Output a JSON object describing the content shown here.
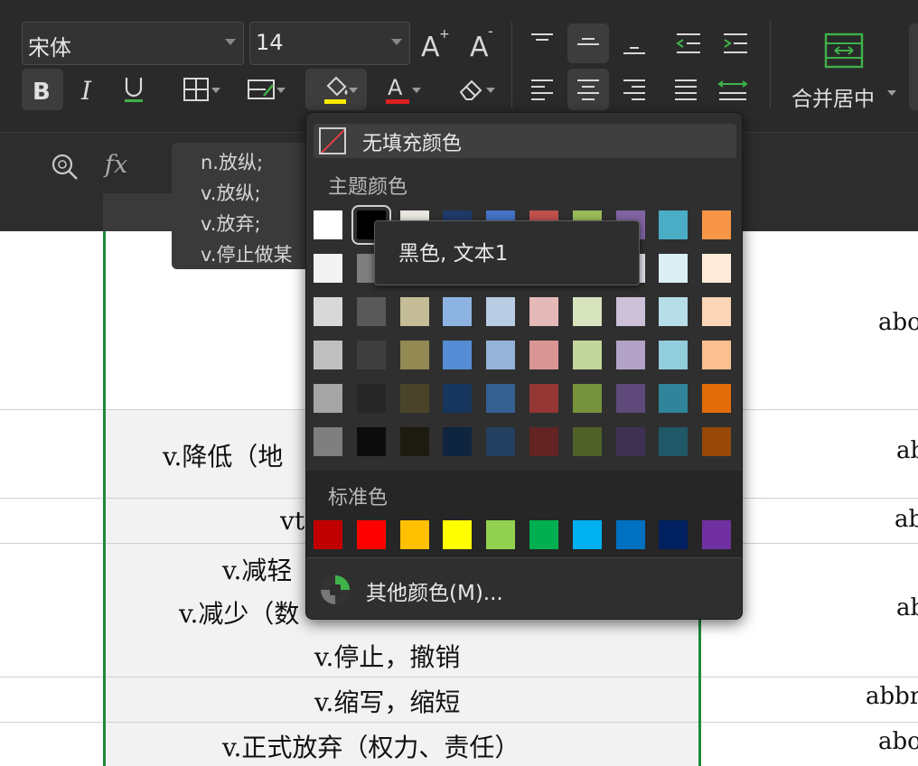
{
  "toolbar": {
    "font_name": "宋体",
    "font_size": "14",
    "merge_center": "合并居中"
  },
  "formula": {
    "fx": "fx",
    "lines": [
      "n.放纵;",
      "v.放纵;",
      "v.放弃;",
      "v.停止做某"
    ]
  },
  "sheet": {
    "rows": [
      {
        "text": "",
        "right": "abo"
      },
      {
        "text": "v.降低（地",
        "right": "ab"
      },
      {
        "text": "vt",
        "right": "ab"
      },
      {
        "text": "v.减轻",
        "text2": "v.减少（数",
        "text3": "v.停止，撤销",
        "right": "ab"
      },
      {
        "text": "v.缩写，缩短",
        "right": "abbr"
      },
      {
        "text": "v.正式放弃（权力、责任）",
        "right": "abo"
      }
    ]
  },
  "color_picker": {
    "no_fill": "无填充颜色",
    "theme_title": "主题颜色",
    "standard_title": "标准色",
    "more_colors": "其他颜色(M)...",
    "tooltip": "黑色, 文本1",
    "theme_colors": [
      [
        "#ffffff",
        "#000000",
        "#e8e6df",
        "#1f3a68",
        "#4472c4",
        "#c0504d",
        "#9bbb59",
        "#8064a2",
        "#4bacc6",
        "#f79646"
      ],
      [
        "#f2f2f2",
        "#7f7f7f",
        "#ddd9c3",
        "#c6d9f0",
        "#dbe5f1",
        "#f2dcdb",
        "#ebf1dd",
        "#e5e0ec",
        "#dbeef3",
        "#fdeada"
      ],
      [
        "#d8d8d8",
        "#595959",
        "#c4bd97",
        "#8db3e2",
        "#b8cce4",
        "#e5b9b7",
        "#d7e3bc",
        "#ccc1d9",
        "#b7dde8",
        "#fbd5b5"
      ],
      [
        "#bfbfbf",
        "#3f3f3f",
        "#938953",
        "#548dd4",
        "#95b3d7",
        "#d99694",
        "#c3d69b",
        "#b2a2c7",
        "#92cddc",
        "#fac08f"
      ],
      [
        "#a5a5a5",
        "#262626",
        "#494429",
        "#17365d",
        "#366092",
        "#953734",
        "#76923c",
        "#5f497a",
        "#31859b",
        "#e36c09"
      ],
      [
        "#7f7f7f",
        "#0c0c0c",
        "#1d1b10",
        "#0f243e",
        "#244061",
        "#632423",
        "#4f6128",
        "#3f3151",
        "#205867",
        "#974806"
      ]
    ],
    "standard_colors": [
      "#c00000",
      "#ff0000",
      "#ffc000",
      "#ffff00",
      "#92d050",
      "#00b050",
      "#00b0f0",
      "#0070c0",
      "#002060",
      "#7030a0"
    ],
    "selected": "#000000"
  },
  "colors": {
    "accent": "#1d8a3a",
    "underline_green": "#3fb24a",
    "fill_highlight": "#ffee00",
    "font_red": "#e02020"
  }
}
